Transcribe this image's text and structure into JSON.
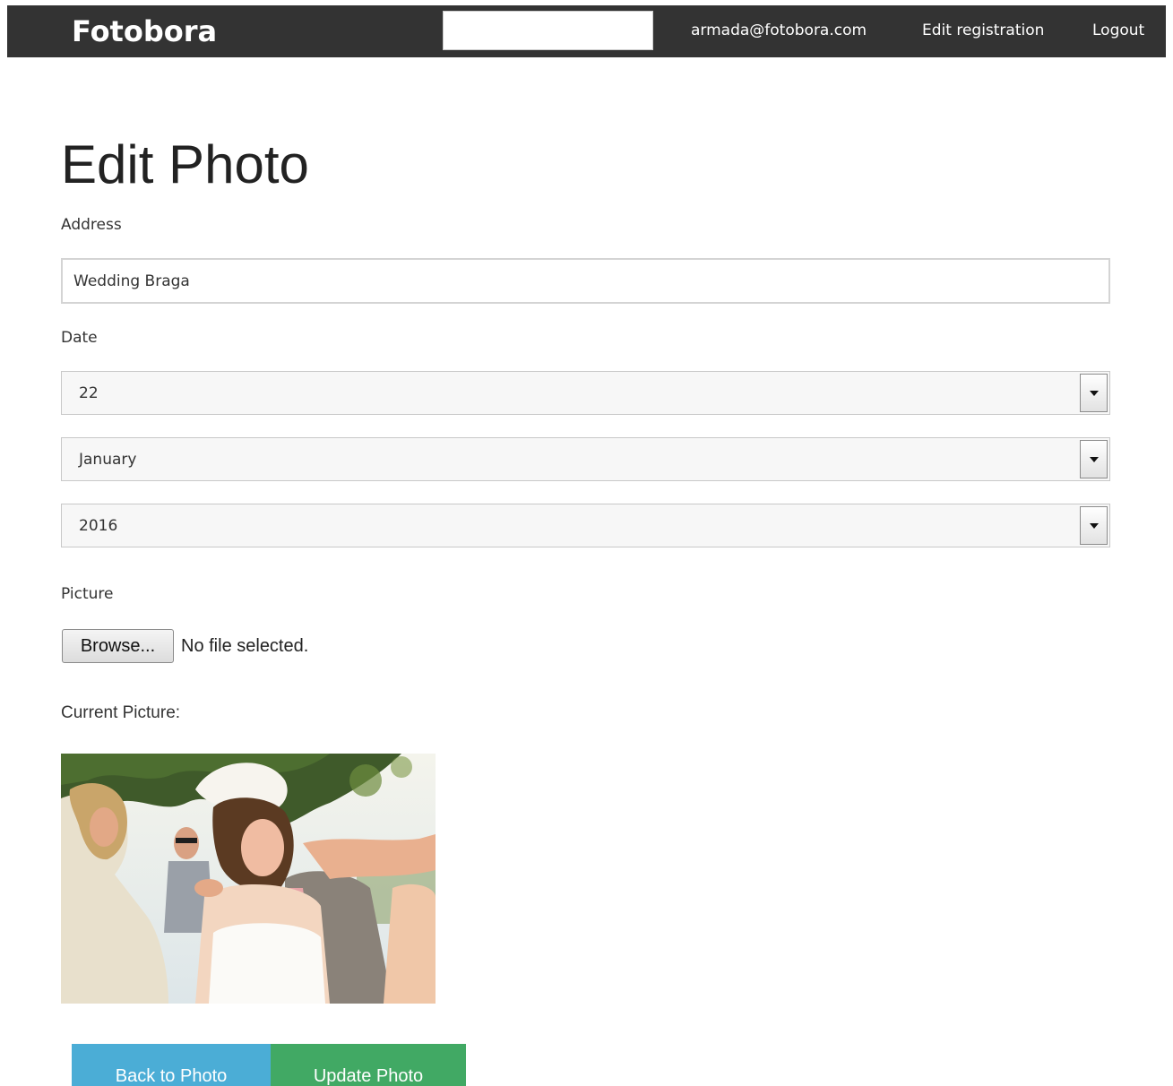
{
  "navbar": {
    "brand": "Fotobora",
    "search_value": "",
    "email": "armada@fotobora.com",
    "edit_registration": "Edit registration",
    "logout": "Logout",
    "background_color": "#333333"
  },
  "form": {
    "title": "Edit Photo",
    "address_label": "Address",
    "address_value": "Wedding Braga",
    "date_label": "Date",
    "day_value": "22",
    "month_value": "January",
    "year_value": "2016",
    "picture_label": "Picture",
    "browse_label": "Browse...",
    "file_status": "No file selected.",
    "current_picture_label": "Current Picture:"
  },
  "actions": {
    "back_label": "Back to Photo",
    "update_label": "Update Photo",
    "back_color": "#4badd6",
    "update_color": "#41a964"
  },
  "icons": {
    "select_arrow": "chevron-down-icon"
  }
}
